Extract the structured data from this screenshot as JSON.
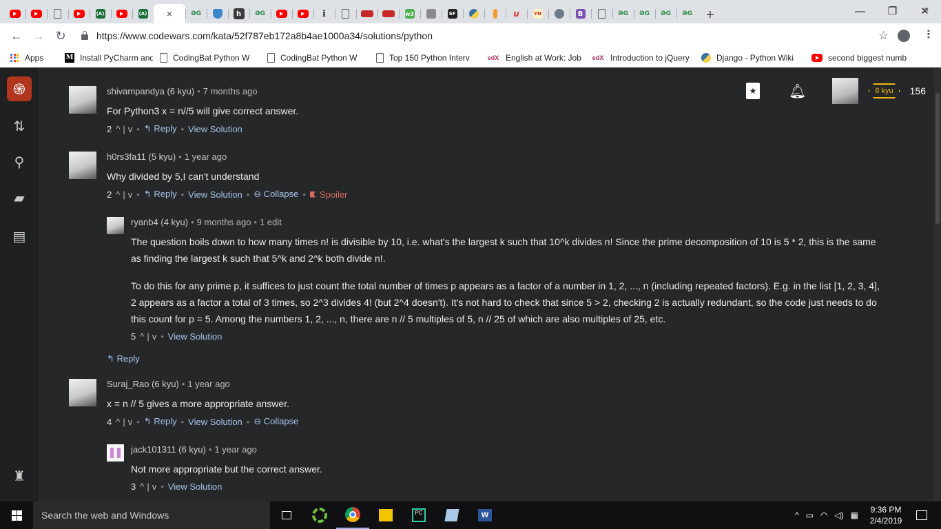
{
  "browser": {
    "tabs": [
      {
        "icon": "youtube-icon"
      },
      {
        "icon": "youtube-icon"
      },
      {
        "icon": "document-icon"
      },
      {
        "icon": "youtube-icon"
      },
      {
        "icon": "codingbat-icon",
        "text": "(A)"
      },
      {
        "icon": "youtube-icon"
      },
      {
        "icon": "codingbat-icon",
        "text": "(A)"
      },
      {
        "icon": "codewars-icon",
        "active": true,
        "close": "×"
      },
      {
        "icon": "gfg-icon",
        "text": "ƏG"
      },
      {
        "icon": "shield-icon"
      },
      {
        "icon": "hackerrank-icon",
        "text": "h"
      },
      {
        "icon": "gfg-icon",
        "text": "ƏG"
      },
      {
        "icon": "youtube-icon"
      },
      {
        "icon": "youtube-icon"
      },
      {
        "icon": "info-icon",
        "text": "i"
      },
      {
        "icon": "document-icon"
      },
      {
        "icon": "red-banner-icon"
      },
      {
        "icon": "red-banner-icon"
      },
      {
        "icon": "w3schools-icon",
        "text": "w3"
      },
      {
        "icon": "gray-tab-icon"
      },
      {
        "icon": "sf-icon",
        "text": "SF"
      },
      {
        "icon": "python-icon"
      },
      {
        "icon": "orange-tab-icon"
      },
      {
        "icon": "udemy-icon",
        "text": "u"
      },
      {
        "icon": "yn-icon",
        "text": "YN"
      },
      {
        "icon": "gear-tab-icon"
      },
      {
        "icon": "bootstrap-icon",
        "text": "B"
      },
      {
        "icon": "document-icon"
      },
      {
        "icon": "gfg-icon",
        "text": "ƏG"
      },
      {
        "icon": "gfg-icon",
        "text": "ƏG"
      },
      {
        "icon": "gfg-icon",
        "text": "ƏG"
      },
      {
        "icon": "gfg-icon",
        "text": "ƏG"
      }
    ],
    "new_tab": "+",
    "window_controls": {
      "minimize": "—",
      "restore": "❐",
      "close": "✕"
    },
    "url": "https://www.codewars.com/kata/52f787eb172a8b4ae1000a34/solutions/python",
    "bookmarks": [
      {
        "icon": "apps-icon",
        "label": "Apps"
      },
      {
        "icon": "medium-icon",
        "icon_text": "M",
        "label": "Install PyCharm and A"
      },
      {
        "icon": "document-icon",
        "label": "CodingBat Python W"
      },
      {
        "icon": "document-icon",
        "label": "CodingBat Python W"
      },
      {
        "icon": "document-icon",
        "label": "Top 150 Python Interv"
      },
      {
        "icon": "edx-icon",
        "icon_text": "edX",
        "label": "English at Work: Job I"
      },
      {
        "icon": "edx-icon",
        "icon_text": "edX",
        "label": "Introduction to jQuery"
      },
      {
        "icon": "python-icon",
        "label": "Django - Python Wiki"
      },
      {
        "icon": "youtube-icon",
        "label": "second biggest numb"
      }
    ],
    "bookmarks_more": "»"
  },
  "header": {
    "rank_badge": "6 kyu",
    "honor": "156"
  },
  "comments": [
    {
      "user": "shivampandya",
      "rank": "(6 kyu)",
      "time": "7 months ago",
      "body": [
        "For Python3 x = n//5 will give correct answer."
      ],
      "votes": "2",
      "reply": "Reply",
      "view_solution": "View Solution"
    },
    {
      "user": "h0rs3fa11",
      "rank": "(5 kyu)",
      "time": "1 year ago",
      "body": [
        "Why divided by 5,I can't understand"
      ],
      "votes": "2",
      "reply": "Reply",
      "view_solution": "View Solution",
      "collapse": "Collapse",
      "spoiler": "Spoiler"
    },
    {
      "user": "ryanb4",
      "rank": "(4 kyu)",
      "time": "9 months ago",
      "edits": "1 edit",
      "body": [
        "The question boils down to how many times n! is divisible by 10, i.e. what's the largest k such that 10^k divides n! Since the prime decomposition of 10 is 5 * 2, this is the same",
        "as finding the largest k such that 5^k and 2^k both divide n!.",
        "To do this for any prime p, it suffices to just count the total number of times p appears as a factor of a number in 1, 2, ..., n (including repeated factors). E.g. in the list [1, 2, 3, 4],",
        "2 appears as a factor a total of 3 times, so 2^3 divides 4! (but 2^4 doesn't). It's not hard to check that since 5 > 2, checking 2 is actually redundant, so the code just needs to do",
        "this count for p = 5. Among the numbers 1, 2, ..., n, there are n // 5 multiples of 5, n // 25 of which are also multiples of 25, etc."
      ],
      "votes": "5",
      "view_solution": "View Solution"
    },
    {
      "user": "Suraj_Rao",
      "rank": "(6 kyu)",
      "time": "1 year ago",
      "body": [
        "x = n // 5 gives a more appropriate answer."
      ],
      "votes": "4",
      "reply": "Reply",
      "view_solution": "View Solution",
      "collapse": "Collapse"
    },
    {
      "user": "jack101311",
      "rank": "(6 kyu)",
      "time": "1 year ago",
      "body": [
        "Not more appropriate but the correct answer."
      ],
      "votes": "3",
      "view_solution": "View Solution"
    }
  ],
  "thread_reply": "Reply",
  "vote_glyphs": {
    "up": "^",
    "bar": "|",
    "down": "v",
    "dot": "•",
    "reply_arrow": "↰"
  },
  "taskbar": {
    "search_placeholder": "Search the web and Windows",
    "time": "9:36 PM",
    "date": "2/4/2019"
  }
}
